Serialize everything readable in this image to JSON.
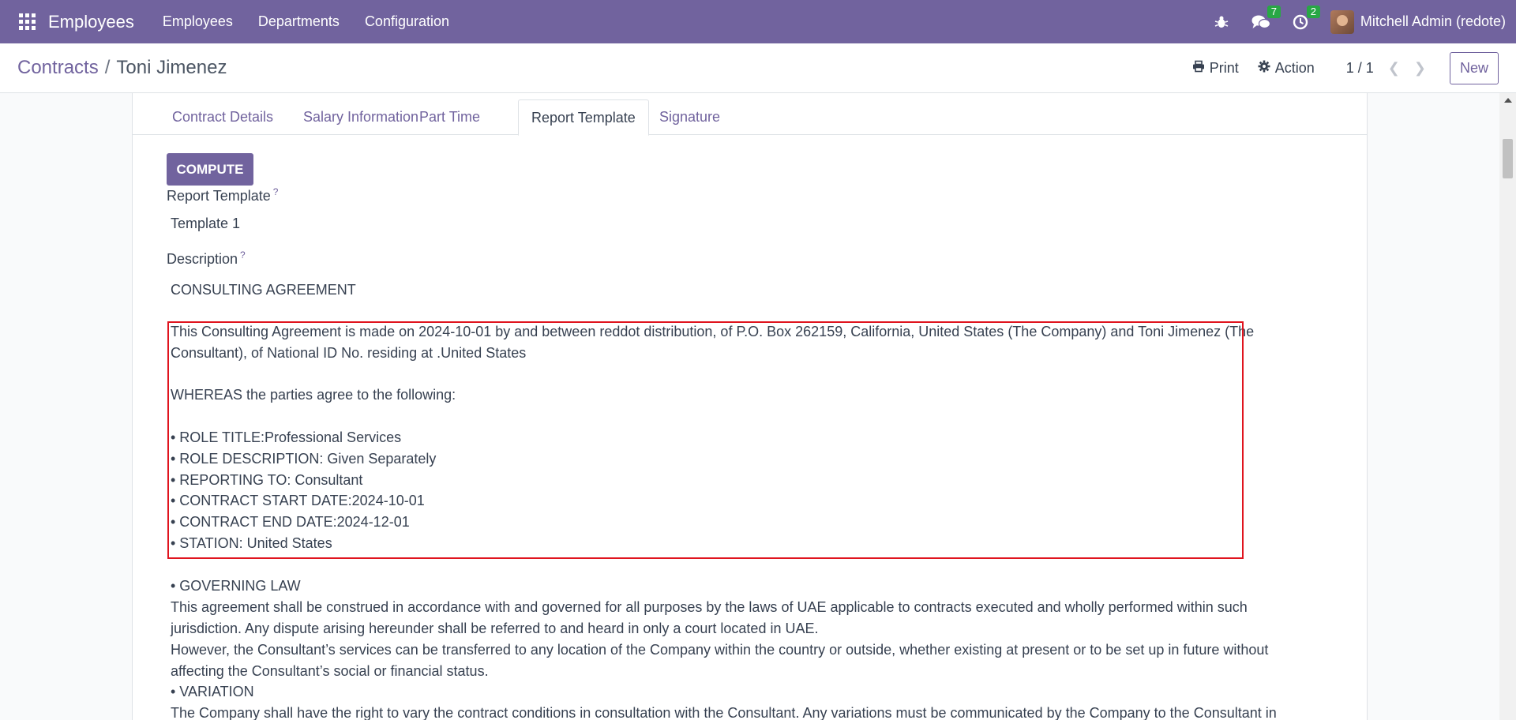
{
  "navbar": {
    "app_name": "Employees",
    "menus": [
      "Employees",
      "Departments",
      "Configuration"
    ],
    "chat_count": "7",
    "activity_count": "2",
    "user_name": "Mitchell Admin (redote)"
  },
  "control": {
    "breadcrumb_parent": "Contracts",
    "breadcrumb_separator": "/",
    "breadcrumb_current": "Toni Jimenez",
    "print_label": "Print",
    "action_label": "Action",
    "pager": "1 / 1",
    "new_label": "New"
  },
  "tabs": [
    "Contract Details",
    "Salary Information",
    "Part Time",
    "Report Template",
    "Signature"
  ],
  "active_tab": "Report Template",
  "form": {
    "compute_label": "COMPUTE",
    "report_template_label": "Report Template",
    "report_template_help": "?",
    "report_template_value": "Template 1",
    "description_label": "Description",
    "description_help": "?",
    "description_lines": [
      "CONSULTING AGREEMENT",
      "This Consulting Agreement is made on 2024-10-01 by and between reddot distribution, of P.O. Box 262159, California, United States (The Company) and Toni Jimenez (The",
      "Consultant), of National ID No. residing at .United States",
      "WHEREAS the parties agree to the following:",
      "• ROLE TITLE:Professional Services",
      "• ROLE DESCRIPTION: Given Separately",
      "• REPORTING TO: Consultant",
      "• CONTRACT START DATE:2024-10-01",
      "• CONTRACT END DATE:2024-12-01",
      "• STATION: United States",
      "• GOVERNING LAW",
      "This agreement shall be construed in accordance with and governed for all purposes by the laws of UAE applicable to contracts executed and wholly performed within such",
      "jurisdiction. Any dispute arising hereunder shall be referred to and heard in only a court located in UAE.",
      "However, the Consultant’s services can be transferred to any location of the Company within the country or outside, whether existing at present or to be set up in future without",
      "affecting the Consultant’s social or financial status.",
      "• VARIATION",
      "The Company shall have the right to vary the contract conditions in consultation with the Consultant. Any variations must be communicated by the Company to the Consultant in"
    ]
  },
  "colors": {
    "brand": "#71639e",
    "badge": "#28a745",
    "highlight": "#e0141e"
  },
  "icons": {
    "apps": "apps-grid-icon",
    "bug": "bug-icon",
    "chat": "chat-icon",
    "activity": "clock-icon",
    "print": "print-icon",
    "action": "gear-icon",
    "prev": "chevron-left-icon",
    "next": "chevron-right-icon"
  }
}
